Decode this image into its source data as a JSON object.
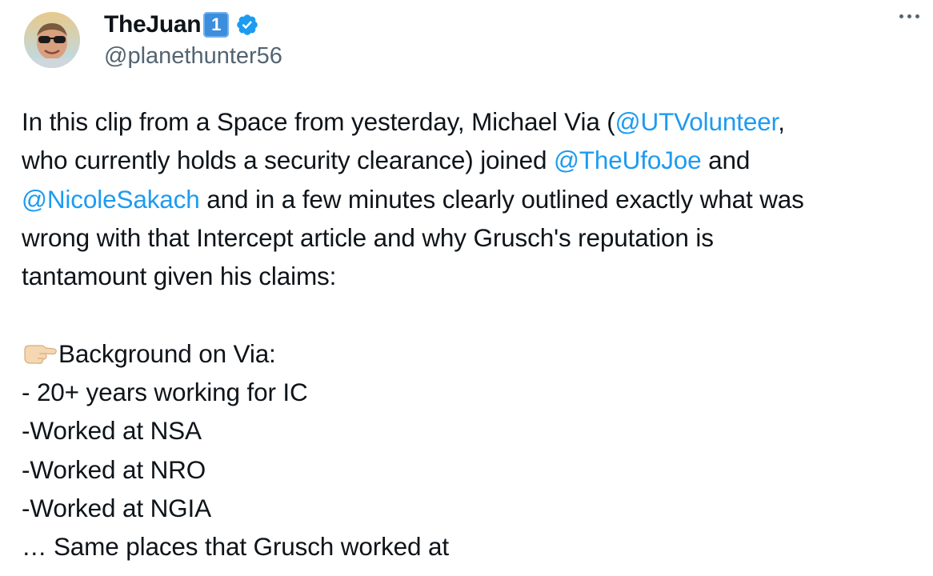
{
  "tweet": {
    "author": {
      "display_name": "TheJuan",
      "keycap": "1",
      "handle": "@planethunter56",
      "verified_icon": "verified-badge-icon",
      "avatar_icon": "avatar-image"
    },
    "more_icon": "more-options-icon",
    "colors": {
      "text": "#0f1419",
      "secondary": "#536471",
      "mention": "#1d9bf0",
      "verified": "#1d9bf0"
    },
    "text": {
      "p1_l1_a": "In this clip from a Space from yesterday, Michael Via (",
      "p1_l1_mention": "@UTVolunteer",
      "p1_l1_b": ",",
      "p1_l2_a": "who currently holds a security clearance) joined ",
      "p1_l2_mention": "@TheUfoJoe",
      "p1_l2_b": " and",
      "p1_l3_mention": "@NicoleSakach",
      "p1_l3_b": " and in a few minutes clearly outlined exactly what was",
      "p1_l4": "wrong with that Intercept article and why Grusch's reputation is",
      "p1_l5": "tantamount given his claims:",
      "p2_emoji_icon": "backhand-index-pointing-right-icon",
      "p2_heading": "Background on Via:",
      "p2_items": [
        "- 20+ years working for IC",
        "-Worked at NSA",
        "-Worked at NRO",
        "-Worked at NGIA",
        "… Same places that Grusch worked at"
      ]
    }
  }
}
